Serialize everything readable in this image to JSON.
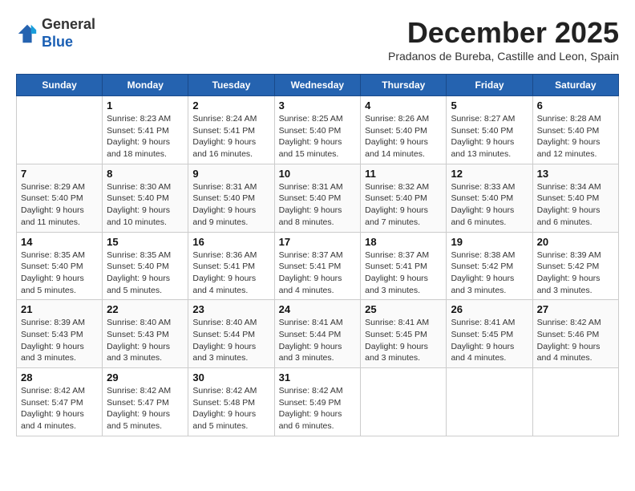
{
  "logo": {
    "general": "General",
    "blue": "Blue"
  },
  "title": "December 2025",
  "subtitle": "Pradanos de Bureba, Castille and Leon, Spain",
  "weekdays": [
    "Sunday",
    "Monday",
    "Tuesday",
    "Wednesday",
    "Thursday",
    "Friday",
    "Saturday"
  ],
  "weeks": [
    [
      {
        "day": "",
        "info": ""
      },
      {
        "day": "1",
        "info": "Sunrise: 8:23 AM\nSunset: 5:41 PM\nDaylight: 9 hours\nand 18 minutes."
      },
      {
        "day": "2",
        "info": "Sunrise: 8:24 AM\nSunset: 5:41 PM\nDaylight: 9 hours\nand 16 minutes."
      },
      {
        "day": "3",
        "info": "Sunrise: 8:25 AM\nSunset: 5:40 PM\nDaylight: 9 hours\nand 15 minutes."
      },
      {
        "day": "4",
        "info": "Sunrise: 8:26 AM\nSunset: 5:40 PM\nDaylight: 9 hours\nand 14 minutes."
      },
      {
        "day": "5",
        "info": "Sunrise: 8:27 AM\nSunset: 5:40 PM\nDaylight: 9 hours\nand 13 minutes."
      },
      {
        "day": "6",
        "info": "Sunrise: 8:28 AM\nSunset: 5:40 PM\nDaylight: 9 hours\nand 12 minutes."
      }
    ],
    [
      {
        "day": "7",
        "info": "Sunrise: 8:29 AM\nSunset: 5:40 PM\nDaylight: 9 hours\nand 11 minutes."
      },
      {
        "day": "8",
        "info": "Sunrise: 8:30 AM\nSunset: 5:40 PM\nDaylight: 9 hours\nand 10 minutes."
      },
      {
        "day": "9",
        "info": "Sunrise: 8:31 AM\nSunset: 5:40 PM\nDaylight: 9 hours\nand 9 minutes."
      },
      {
        "day": "10",
        "info": "Sunrise: 8:31 AM\nSunset: 5:40 PM\nDaylight: 9 hours\nand 8 minutes."
      },
      {
        "day": "11",
        "info": "Sunrise: 8:32 AM\nSunset: 5:40 PM\nDaylight: 9 hours\nand 7 minutes."
      },
      {
        "day": "12",
        "info": "Sunrise: 8:33 AM\nSunset: 5:40 PM\nDaylight: 9 hours\nand 6 minutes."
      },
      {
        "day": "13",
        "info": "Sunrise: 8:34 AM\nSunset: 5:40 PM\nDaylight: 9 hours\nand 6 minutes."
      }
    ],
    [
      {
        "day": "14",
        "info": "Sunrise: 8:35 AM\nSunset: 5:40 PM\nDaylight: 9 hours\nand 5 minutes."
      },
      {
        "day": "15",
        "info": "Sunrise: 8:35 AM\nSunset: 5:40 PM\nDaylight: 9 hours\nand 5 minutes."
      },
      {
        "day": "16",
        "info": "Sunrise: 8:36 AM\nSunset: 5:41 PM\nDaylight: 9 hours\nand 4 minutes."
      },
      {
        "day": "17",
        "info": "Sunrise: 8:37 AM\nSunset: 5:41 PM\nDaylight: 9 hours\nand 4 minutes."
      },
      {
        "day": "18",
        "info": "Sunrise: 8:37 AM\nSunset: 5:41 PM\nDaylight: 9 hours\nand 3 minutes."
      },
      {
        "day": "19",
        "info": "Sunrise: 8:38 AM\nSunset: 5:42 PM\nDaylight: 9 hours\nand 3 minutes."
      },
      {
        "day": "20",
        "info": "Sunrise: 8:39 AM\nSunset: 5:42 PM\nDaylight: 9 hours\nand 3 minutes."
      }
    ],
    [
      {
        "day": "21",
        "info": "Sunrise: 8:39 AM\nSunset: 5:43 PM\nDaylight: 9 hours\nand 3 minutes."
      },
      {
        "day": "22",
        "info": "Sunrise: 8:40 AM\nSunset: 5:43 PM\nDaylight: 9 hours\nand 3 minutes."
      },
      {
        "day": "23",
        "info": "Sunrise: 8:40 AM\nSunset: 5:44 PM\nDaylight: 9 hours\nand 3 minutes."
      },
      {
        "day": "24",
        "info": "Sunrise: 8:41 AM\nSunset: 5:44 PM\nDaylight: 9 hours\nand 3 minutes."
      },
      {
        "day": "25",
        "info": "Sunrise: 8:41 AM\nSunset: 5:45 PM\nDaylight: 9 hours\nand 3 minutes."
      },
      {
        "day": "26",
        "info": "Sunrise: 8:41 AM\nSunset: 5:45 PM\nDaylight: 9 hours\nand 4 minutes."
      },
      {
        "day": "27",
        "info": "Sunrise: 8:42 AM\nSunset: 5:46 PM\nDaylight: 9 hours\nand 4 minutes."
      }
    ],
    [
      {
        "day": "28",
        "info": "Sunrise: 8:42 AM\nSunset: 5:47 PM\nDaylight: 9 hours\nand 4 minutes."
      },
      {
        "day": "29",
        "info": "Sunrise: 8:42 AM\nSunset: 5:47 PM\nDaylight: 9 hours\nand 5 minutes."
      },
      {
        "day": "30",
        "info": "Sunrise: 8:42 AM\nSunset: 5:48 PM\nDaylight: 9 hours\nand 5 minutes."
      },
      {
        "day": "31",
        "info": "Sunrise: 8:42 AM\nSunset: 5:49 PM\nDaylight: 9 hours\nand 6 minutes."
      },
      {
        "day": "",
        "info": ""
      },
      {
        "day": "",
        "info": ""
      },
      {
        "day": "",
        "info": ""
      }
    ]
  ]
}
